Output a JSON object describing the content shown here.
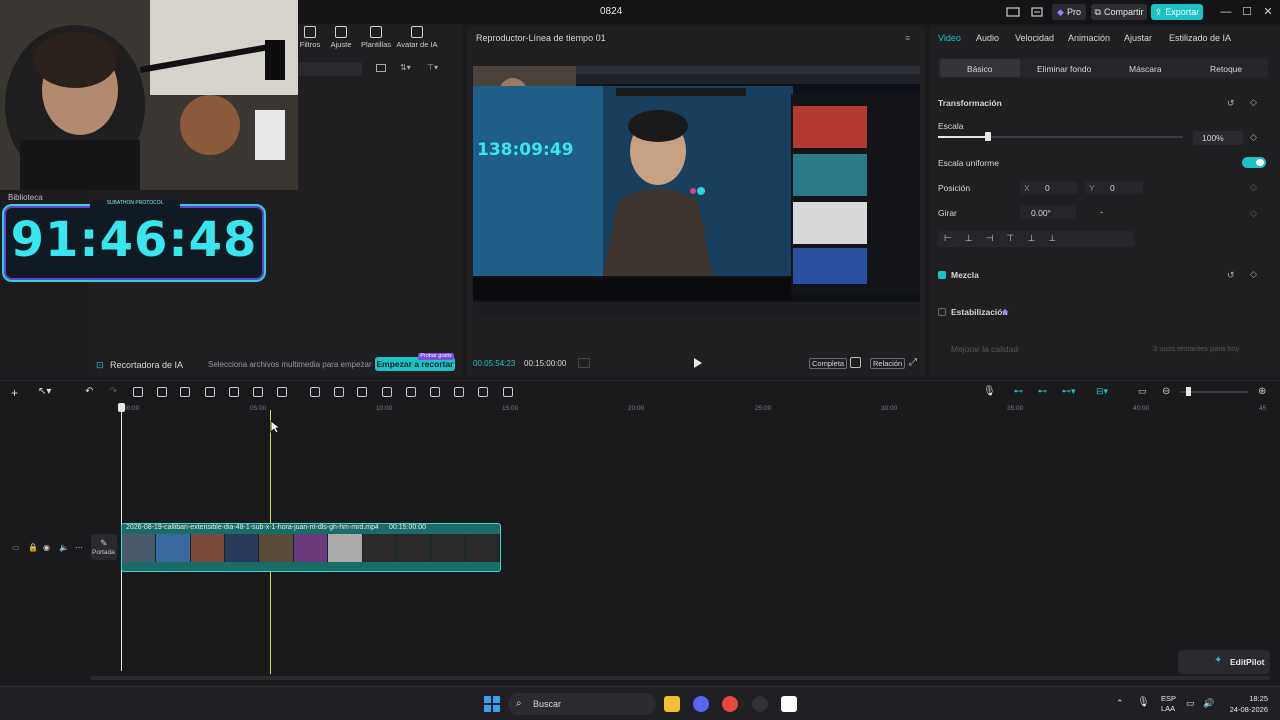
{
  "app": {
    "window_title": "0824"
  },
  "titlebar": {
    "pro_label": "Pro",
    "share_label": "Compartir",
    "export_label": "Exportar"
  },
  "media_tools": [
    "Filtros",
    "Ajuste",
    "Plantillas",
    "Avatar de IA"
  ],
  "left_panel": {
    "library_label": "Biblioteca",
    "counter_label": "SUBATHON PROTOCOL",
    "counter_value": "91:46:48",
    "ai_recorder_label": "Grabadora de IA",
    "ai_recorder_label_shown": "Recortadora de IA",
    "ai_recorder_hint": "Selecciona archivos multimedia para empezar",
    "start_button_label": "Empezar a recortar",
    "free_trial_badge": "Probar gratis"
  },
  "player": {
    "title": "Reproductor-Línea de tiempo 01",
    "current_time": "00:05:54:23",
    "total_time": "00:15:00:00",
    "btn_full": "Completa",
    "btn_ratio": "Relación",
    "video_overlay_timer": "138:09:49"
  },
  "right_panel": {
    "tabs": [
      "Video",
      "Audio",
      "Velocidad",
      "Animación",
      "Ajustar",
      "Estilizado de IA"
    ],
    "subtabs": [
      "Básico",
      "Eliminar fondo",
      "Máscara",
      "Retoque"
    ],
    "transform_label": "Transformación",
    "scale_label": "Escala",
    "scale_value": "100%",
    "scale_fraction": 0.2,
    "uniform_scale_label": "Escala uniforme",
    "position_label": "Posición",
    "pos_x_label": "X",
    "pos_x_value": "0",
    "pos_y_label": "Y",
    "pos_y_value": "0",
    "rotate_label": "Girar",
    "rotate_value": "0.00°",
    "blend_label": "Mezcla",
    "stabilize_label": "Estabilización",
    "quality_label": "Mejorar la calidad",
    "quality_hint": "3 usos restantes para hoy"
  },
  "timeline": {
    "ruler": [
      "00:00",
      "05:00",
      "10:00",
      "15:00",
      "20:00",
      "25:00",
      "30:00",
      "35:00",
      "40:00",
      "45"
    ],
    "clip_name": "2026-08-19-calliban-extensible-dia-48-1-sub-x-1-hora-juan-nt-dls-gh-hm-mrd.mp4",
    "clip_duration": "00:15:00:00",
    "cover_label": "Portada",
    "editpilot_label": "EditPilot"
  },
  "taskbar": {
    "search_placeholder": "Buscar",
    "lang_line1": "ESP",
    "lang_line2": "LAA",
    "time": "18:25",
    "date": "24-08-2026"
  },
  "colors": {
    "accent": "#1bc3c4",
    "purple": "#7a4ce0",
    "panel": "#1f1f22"
  }
}
